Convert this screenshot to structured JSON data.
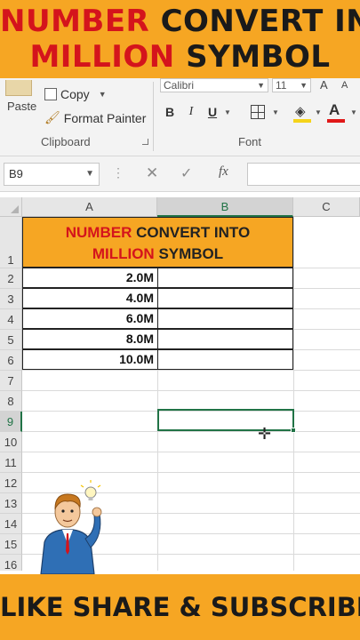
{
  "banner": {
    "line1_red": "NUMBER",
    "line1_dark": "CONVERT IN",
    "line2_red": "MILLION",
    "line2_dark": "SYMBOL"
  },
  "ribbon": {
    "paste_label": "Paste",
    "copy_label": "Copy",
    "format_painter_label": "Format Painter",
    "clipboard_group": "Clipboard",
    "font_name": "Calibri",
    "font_size": "11",
    "grow_font": "A",
    "shrink_font": "A",
    "bold": "B",
    "italic": "I",
    "underline": "U",
    "font_color_glyph": "A",
    "font_group": "Font",
    "colors": {
      "fill": "#f5d31a",
      "font_color": "#e01818"
    }
  },
  "formula_bar": {
    "name_box": "B9",
    "cancel_glyph": "✕",
    "enter_glyph": "✓",
    "fx_label": "fx",
    "formula": ""
  },
  "grid": {
    "columns": [
      "A",
      "B",
      "C"
    ],
    "rows": [
      "1",
      "2",
      "3",
      "4",
      "5",
      "6",
      "7",
      "8",
      "9",
      "10",
      "11",
      "12",
      "13",
      "14",
      "15",
      "16"
    ],
    "header_line1_red": "NUMBER",
    "header_line1_dark": "CONVERT INTO",
    "header_line2_red": "MILLION",
    "header_line2_dark": "SYMBOL",
    "values": [
      "2.0M",
      "4.0M",
      "6.0M",
      "8.0M",
      "10.0M"
    ],
    "selected_cell": "B9",
    "accent_color": "#217346",
    "header_fill": "#f6a623"
  },
  "footer": {
    "text": "LIKE SHARE & SUBSCRIBE"
  }
}
